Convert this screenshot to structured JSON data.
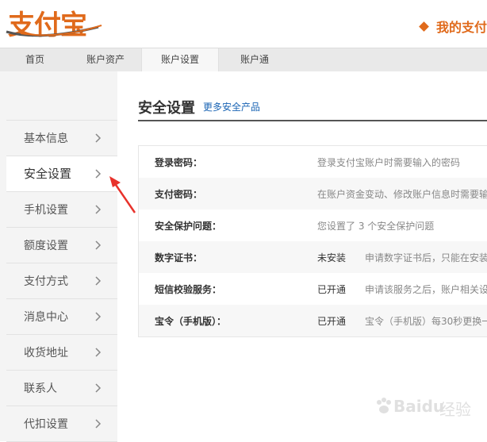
{
  "header": {
    "logo_text": "支付宝",
    "my_pay_label": "我的支付"
  },
  "topnav": {
    "items": [
      {
        "label": "首页",
        "active": false
      },
      {
        "label": "账户资产",
        "active": false
      },
      {
        "label": "账户设置",
        "active": true
      },
      {
        "label": "账户通",
        "active": false
      }
    ]
  },
  "sidebar": {
    "items": [
      {
        "label": "基本信息",
        "active": false
      },
      {
        "label": "安全设置",
        "active": true
      },
      {
        "label": "手机设置",
        "active": false
      },
      {
        "label": "额度设置",
        "active": false
      },
      {
        "label": "支付方式",
        "active": false
      },
      {
        "label": "消息中心",
        "active": false
      },
      {
        "label": "收货地址",
        "active": false
      },
      {
        "label": "联系人",
        "active": false
      },
      {
        "label": "代扣设置",
        "active": false
      }
    ]
  },
  "main": {
    "title": "安全设置",
    "more_link": "更多安全产品",
    "rows": [
      {
        "label": "登录密码：",
        "status": "",
        "desc": "登录支付宝账户时需要输入的密码"
      },
      {
        "label": "支付密码：",
        "status": "",
        "desc": "在账户资金变动、修改账户信息时需要输"
      },
      {
        "label": "安全保护问题：",
        "status": "",
        "desc": "您设置了 3 个安全保护问题"
      },
      {
        "label": "数字证书：",
        "status": "未安装",
        "desc": "申请数字证书后，只能在安装"
      },
      {
        "label": "短信校验服务：",
        "status": "已开通",
        "desc": "申请该服务之后，账户相关设"
      },
      {
        "label": "宝令（手机版）：",
        "status": "已开通",
        "desc": "宝令（手机版）每30秒更换一"
      }
    ]
  },
  "watermark": {
    "text": "Baidu",
    "sub": "经验"
  },
  "colors": {
    "brand_orange": "#e06a1b",
    "link_blue": "#1a64b4",
    "arrow_red": "#e8322b"
  }
}
